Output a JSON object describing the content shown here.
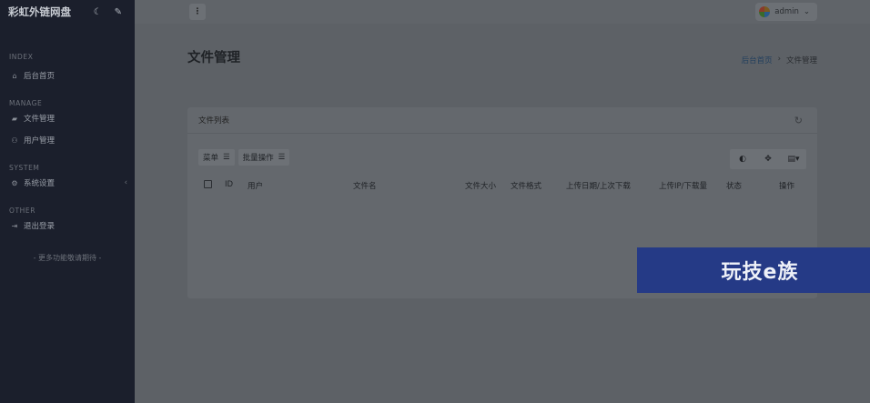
{
  "sidebar": {
    "brand": "彩虹外链网盘",
    "theme_icon": "moon-icon",
    "edit_icon": "pencil-icon",
    "sections": {
      "index": "INDEX",
      "manage": "MANAGE",
      "system": "SYSTEM",
      "other": "OTHER"
    },
    "items": {
      "home": {
        "label": "后台首页",
        "icon": "home-icon"
      },
      "files": {
        "label": "文件管理",
        "icon": "folder-icon"
      },
      "users": {
        "label": "用户管理",
        "icon": "users-icon"
      },
      "settings": {
        "label": "系统设置",
        "icon": "gear-icon"
      },
      "logout": {
        "label": "退出登录",
        "icon": "logout-icon"
      }
    },
    "more": "- 更多功能敬请期待 -"
  },
  "topbar": {
    "menu_icon": "kebab-icon",
    "user": "admin"
  },
  "page": {
    "title": "文件管理",
    "breadcrumb": [
      "后台首页",
      "文件管理"
    ]
  },
  "card": {
    "title": "文件列表",
    "toolbar": {
      "menu": "菜单",
      "batch": "批量操作"
    },
    "right_tools": [
      "toggle-icon",
      "move-icon",
      "columns-icon"
    ],
    "columns": [
      "ID",
      "用户",
      "文件名",
      "文件大小",
      "文件格式",
      "上传日期/上次下载",
      "上传IP/下载量",
      "状态",
      "操作"
    ]
  },
  "watermark": {
    "text": "玩技e族",
    "color": "#253a86"
  }
}
